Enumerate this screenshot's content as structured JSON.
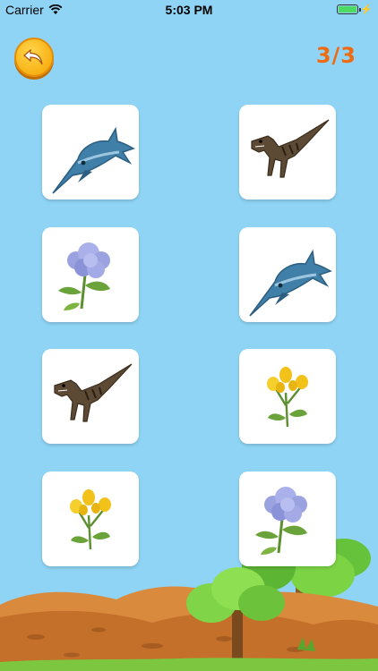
{
  "status_bar": {
    "carrier": "Carrier",
    "time": "5:03 PM"
  },
  "header": {
    "back_icon": "undo-arrow-icon",
    "score": "3/3"
  },
  "cards": [
    {
      "image": "ichthyosaur"
    },
    {
      "image": "tyrannosaurus"
    },
    {
      "image": "hydrangea-flower"
    },
    {
      "image": "ichthyosaur"
    },
    {
      "image": "tyrannosaurus"
    },
    {
      "image": "yellow-tulips"
    },
    {
      "image": "yellow-tulips"
    },
    {
      "image": "hydrangea-flower"
    }
  ],
  "colors": {
    "sky": "#8fd4f5",
    "score": "#ef6b12",
    "back_button": "#f5a300"
  }
}
